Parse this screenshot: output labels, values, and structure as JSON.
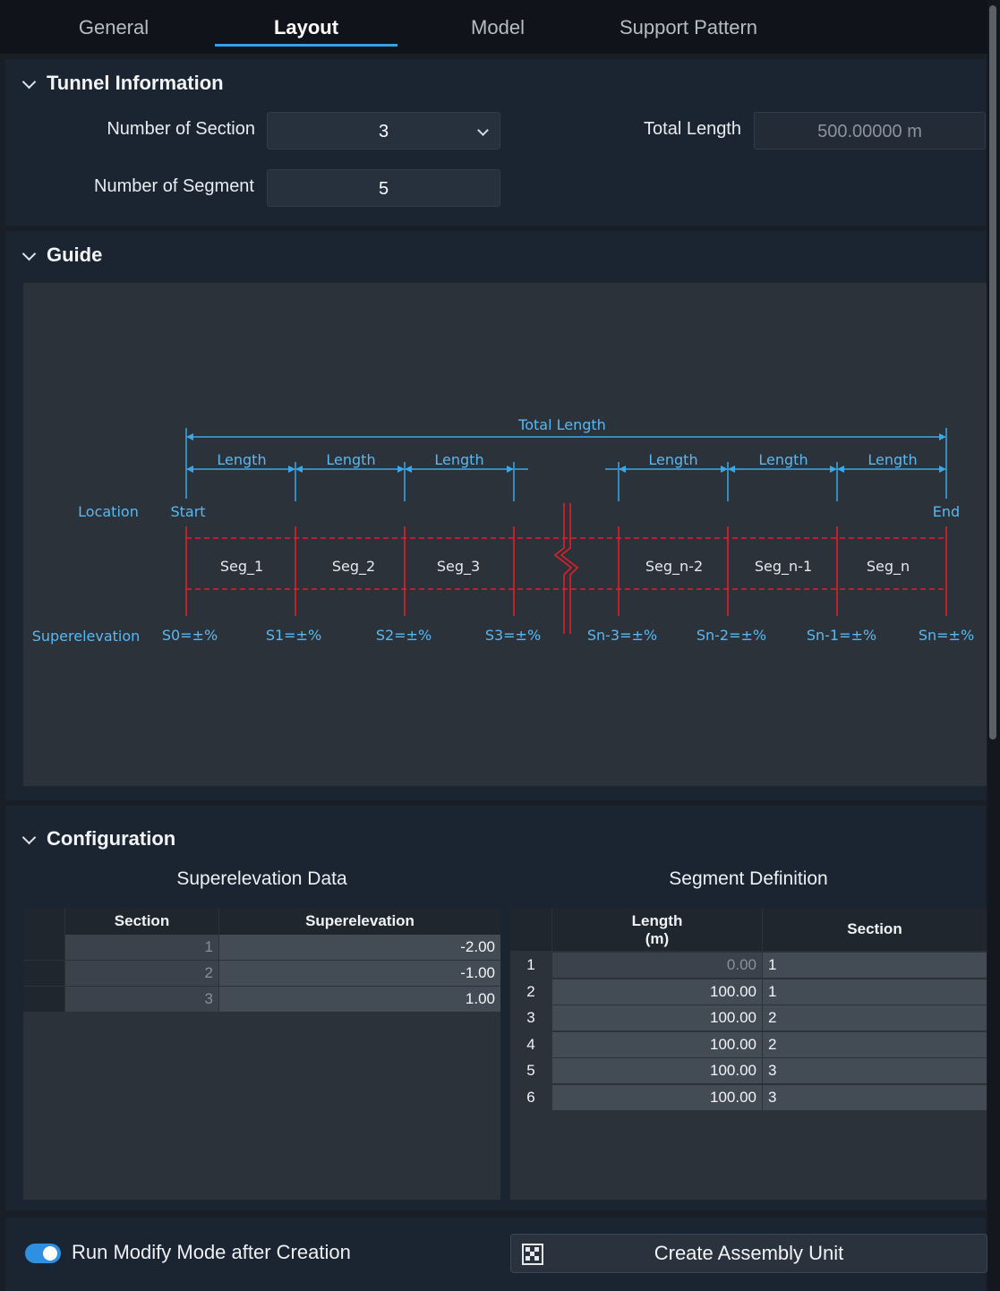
{
  "tabs": [
    {
      "label": "General"
    },
    {
      "label": "Layout"
    },
    {
      "label": "Model"
    },
    {
      "label": "Support Pattern"
    }
  ],
  "tunnel_info": {
    "title": "Tunnel Information",
    "num_section_label": "Number of Section",
    "num_section_value": "3",
    "num_segment_label": "Number of Segment",
    "num_segment_value": "5",
    "total_length_label": "Total Length",
    "total_length_value": "500.00000 m"
  },
  "guide": {
    "title": "Guide",
    "total_length": "Total Length",
    "length_label": "Length",
    "location_label": "Location",
    "start": "Start",
    "end": "End",
    "superelevation_label": "Superelevation",
    "segments": [
      "Seg_1",
      "Seg_2",
      "Seg_3",
      "Seg_n-2",
      "Seg_n-1",
      "Seg_n"
    ],
    "slopes": [
      "S0=±%",
      "S1=±%",
      "S2=±%",
      "S3=±%",
      "Sn-3=±%",
      "Sn-2=±%",
      "Sn-1=±%",
      "Sn=±%"
    ],
    "colors": {
      "dimension": "#3aa8e8",
      "segment": "#e02027"
    }
  },
  "configuration": {
    "title": "Configuration",
    "superelevation": {
      "title": "Superelevation Data",
      "headers": [
        "Section",
        "Superelevation"
      ],
      "rows": [
        {
          "section": "1",
          "value": "-2.00"
        },
        {
          "section": "2",
          "value": "-1.00"
        },
        {
          "section": "3",
          "value": "1.00"
        }
      ]
    },
    "segment_def": {
      "title": "Segment Definition",
      "header_length_1": "Length",
      "header_length_2": "(m)",
      "header_section": "Section",
      "rows": [
        {
          "idx": "1",
          "length": "0.00",
          "section": "1"
        },
        {
          "idx": "2",
          "length": "100.00",
          "section": "1"
        },
        {
          "idx": "3",
          "length": "100.00",
          "section": "2"
        },
        {
          "idx": "4",
          "length": "100.00",
          "section": "2"
        },
        {
          "idx": "5",
          "length": "100.00",
          "section": "3"
        },
        {
          "idx": "6",
          "length": "100.00",
          "section": "3"
        }
      ]
    }
  },
  "footer": {
    "toggle_label": "Run Modify Mode after Creation",
    "toggle_on": true,
    "create_button": "Create Assembly Unit"
  }
}
